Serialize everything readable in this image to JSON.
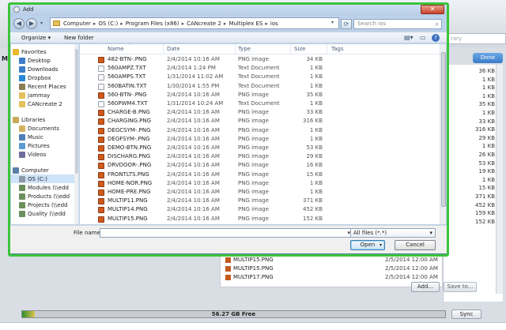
{
  "background_app": {
    "search_placeholder": "rary",
    "done_label": "Done",
    "side_letter": "M",
    "sizes": [
      "36 KB",
      "1 KB",
      "1 KB",
      "1 KB",
      "35 KB",
      "1 KB",
      "33 KB",
      "316 KB",
      "29 KB",
      "1 KB",
      "26 KB",
      "53 KB",
      "19 KB",
      "1 KB",
      "15 KB",
      "371 KB",
      "452 KB",
      "159 KB",
      "152 KB"
    ],
    "files": [
      {
        "name": "MULTIP15.PNG",
        "date": "2/5/2014 12:00 AM"
      },
      {
        "name": "MULTIP15.PNG",
        "date": "2/5/2014 12:00 AM"
      },
      {
        "name": "MULTIP17.PNG",
        "date": "2/5/2014 12:00 AM"
      }
    ],
    "add_label": "Add...",
    "save_to_label": "Save to...",
    "capacity_label": "56.27 GB Free",
    "capacity_used_fraction": 0.03,
    "sync_label": "Sync",
    "colors": {
      "capacity_green": "#2f8d2f",
      "capacity_yellow": "#ddc44a",
      "done_blue": "#3a7cc9"
    }
  },
  "dialog": {
    "title": "Add",
    "close_icon": "close-icon",
    "breadcrumbs": [
      "Computer",
      "OS (C:)",
      "Program Files (x86)",
      "CANcreate 2",
      "Multiplex ES",
      "ios"
    ],
    "search_placeholder": "Search ios",
    "toolbar": {
      "organize_label": "Organize ▾",
      "new_folder_label": "New folder"
    },
    "highlight_color": "#3cc43c",
    "nav": [
      {
        "label": "Favorites",
        "icon": "star-icon",
        "indent": 0,
        "color": "#e8b730"
      },
      {
        "label": "Desktop",
        "icon": "desktop-icon",
        "indent": 1,
        "color": "#3d7cc9"
      },
      {
        "label": "Downloads",
        "icon": "downloads-icon",
        "indent": 1,
        "color": "#3d7cc9"
      },
      {
        "label": "Dropbox",
        "icon": "dropbox-icon",
        "indent": 1,
        "color": "#2a87d8"
      },
      {
        "label": "Recent Places",
        "icon": "recent-places-icon",
        "indent": 1,
        "color": "#8a7d52"
      },
      {
        "label": "jammay",
        "icon": "folder-icon",
        "indent": 1,
        "color": "#e5c15c"
      },
      {
        "label": "CANcreate 2",
        "icon": "folder-icon",
        "indent": 1,
        "color": "#e5c15c"
      },
      {
        "label": "Libraries",
        "icon": "libraries-icon",
        "indent": 0,
        "color": "#c9a857"
      },
      {
        "label": "Documents",
        "icon": "documents-icon",
        "indent": 1,
        "color": "#d3b35f"
      },
      {
        "label": "Music",
        "icon": "music-icon",
        "indent": 1,
        "color": "#4f7fb8"
      },
      {
        "label": "Pictures",
        "icon": "pictures-icon",
        "indent": 1,
        "color": "#5a9bd5"
      },
      {
        "label": "Videos",
        "icon": "videos-icon",
        "indent": 1,
        "color": "#6d6d9c"
      },
      {
        "label": "Computer",
        "icon": "computer-icon",
        "indent": 0,
        "color": "#5b7fa8"
      },
      {
        "label": "OS (C:)",
        "icon": "drive-icon",
        "indent": 1,
        "color": "#8d98a6",
        "selected": true
      },
      {
        "label": "Modules (\\\\edd",
        "icon": "network-drive-icon",
        "indent": 1,
        "color": "#6b8f5a"
      },
      {
        "label": "Products (\\\\edd",
        "icon": "network-drive-icon",
        "indent": 1,
        "color": "#6b8f5a"
      },
      {
        "label": "Projects (\\\\edd",
        "icon": "network-drive-icon",
        "indent": 1,
        "color": "#6b8f5a"
      },
      {
        "label": "Quality (\\\\edd",
        "icon": "network-drive-icon",
        "indent": 1,
        "color": "#6b8f5a"
      }
    ],
    "columns": {
      "name": "Name",
      "date": "Date",
      "type": "Type",
      "size": "Size",
      "tags": "Tags"
    },
    "files": [
      {
        "name": "482-BTN-.PNG",
        "date": "2/4/2014 10:16 AM",
        "type": "PNG image",
        "size": "34 KB",
        "kind": "png"
      },
      {
        "name": "560AMPZ.TXT",
        "date": "2/4/2014 1:24 PM",
        "type": "Text Document",
        "size": "1 KB",
        "kind": "txt"
      },
      {
        "name": "560AMPS.TXT",
        "date": "1/31/2014 11:02 AM",
        "type": "Text Document",
        "size": "1 KB",
        "kind": "txt"
      },
      {
        "name": "560BATIN.TXT",
        "date": "1/30/2014 1:55 PM",
        "type": "Text Document",
        "size": "1 KB",
        "kind": "txt"
      },
      {
        "name": "560-BTN-.PNG",
        "date": "2/4/2014 10:16 AM",
        "type": "PNG image",
        "size": "35 KB",
        "kind": "png"
      },
      {
        "name": "560PWM4.TXT",
        "date": "1/31/2014 10:24 AM",
        "type": "Text Document",
        "size": "1 KB",
        "kind": "txt"
      },
      {
        "name": "CHARGE-B.PNG",
        "date": "2/4/2014 10:16 AM",
        "type": "PNG image",
        "size": "33 KB",
        "kind": "png"
      },
      {
        "name": "CHARGING.PNG",
        "date": "2/4/2014 10:16 AM",
        "type": "PNG image",
        "size": "316 KB",
        "kind": "png"
      },
      {
        "name": "DEGCSYM-.PNG",
        "date": "2/4/2014 10:16 AM",
        "type": "PNG image",
        "size": "1 KB",
        "kind": "png"
      },
      {
        "name": "DEGFSYM-.PNG",
        "date": "2/4/2014 10:16 AM",
        "type": "PNG image",
        "size": "1 KB",
        "kind": "png"
      },
      {
        "name": "DEMO-BTN.PNG",
        "date": "2/4/2014 10:16 AM",
        "type": "PNG image",
        "size": "53 KB",
        "kind": "png"
      },
      {
        "name": "DISCHARG.PNG",
        "date": "2/4/2014 10:16 AM",
        "type": "PNG image",
        "size": "29 KB",
        "kind": "png"
      },
      {
        "name": "DRVDOOR-.PNG",
        "date": "2/4/2014 10:16 AM",
        "type": "PNG image",
        "size": "16 KB",
        "kind": "png"
      },
      {
        "name": "FRONTLTS.PNG",
        "date": "2/4/2014 10:16 AM",
        "type": "PNG image",
        "size": "15 KB",
        "kind": "png"
      },
      {
        "name": "HOME-NOR.PNG",
        "date": "2/4/2014 10:16 AM",
        "type": "PNG image",
        "size": "1 KB",
        "kind": "png"
      },
      {
        "name": "HOME-PRE.PNG",
        "date": "2/4/2014 10:16 AM",
        "type": "PNG image",
        "size": "1 KB",
        "kind": "png"
      },
      {
        "name": "MULTIP11.PNG",
        "date": "2/4/2014 10:16 AM",
        "type": "PNG image",
        "size": "371 KB",
        "kind": "png"
      },
      {
        "name": "MULTIP14.PNG",
        "date": "2/4/2014 10:16 AM",
        "type": "PNG image",
        "size": "452 KB",
        "kind": "png"
      },
      {
        "name": "MULTIP15.PNG",
        "date": "2/4/2014 10:16 AM",
        "type": "PNG image",
        "size": "152 KB",
        "kind": "png"
      }
    ],
    "file_name_label": "File name:",
    "file_name_value": "",
    "filter_value": "All files (*.*)",
    "open_label": "Open",
    "cancel_label": "Cancel"
  }
}
